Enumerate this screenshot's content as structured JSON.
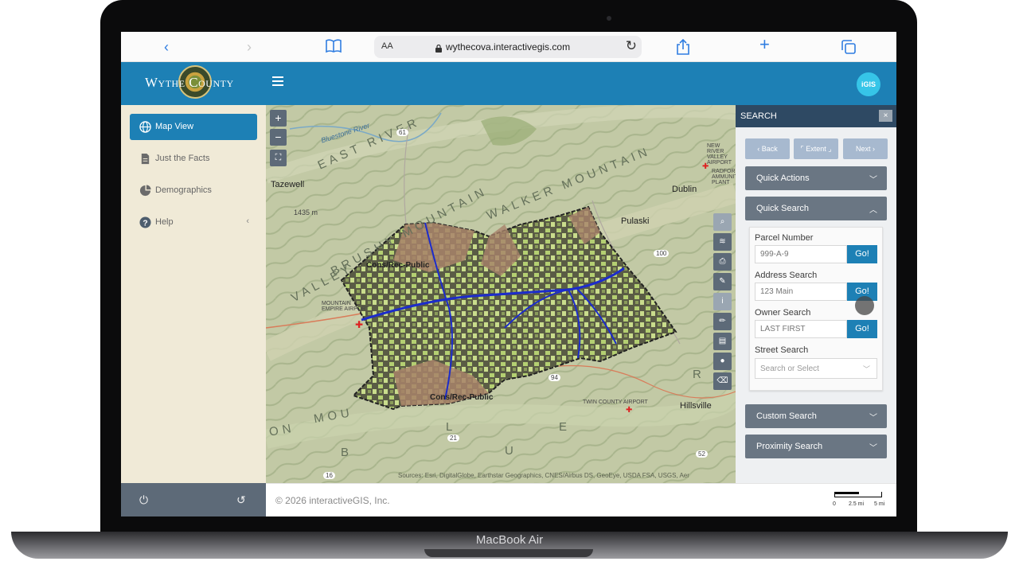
{
  "device": {
    "brand_label": "MacBook Air"
  },
  "browser": {
    "text_size_label": "AA",
    "url": "wythecova.interactivegis.com",
    "icons": [
      "back-icon",
      "forward-icon",
      "bookmarks-icon",
      "lock-icon",
      "reload-icon",
      "share-icon",
      "new-tab-icon",
      "tabs-icon"
    ]
  },
  "header": {
    "logo_text": "Wythe County",
    "badge_text": "iGIS",
    "color": "#1d80b5"
  },
  "sidebar": {
    "items": [
      {
        "label": "Map View",
        "icon": "globe-icon",
        "active": true
      },
      {
        "label": "Just the Facts",
        "icon": "document-icon",
        "active": false
      },
      {
        "label": "Demographics",
        "icon": "pie-chart-icon",
        "active": false
      },
      {
        "label": "Help",
        "icon": "help-icon",
        "active": false
      }
    ],
    "footer_icons": [
      "power-icon",
      "undo-icon"
    ]
  },
  "map": {
    "zoom_in": "+",
    "zoom_out": "−",
    "labels": {
      "tazewell": "Tazewell",
      "dublin": "Dublin",
      "pulaski": "Pulaski",
      "hillsville": "Hillsville",
      "cons_rec_1": "Cons/Rec-Public",
      "cons_rec_2": "Cons/Rec-Public",
      "elevation": "1435 m",
      "mountain_empire": "MOUNTAIN EMPIRE AIRPORT",
      "new_river_airport": "NEW RIVER VALLEY AIRPORT",
      "radford": "RADFORD AMMUNITION PLANT",
      "twin_county": "TWIN COUNTY AIRPORT",
      "bluestone": "Bluestone River",
      "ridge_east": "EAST RIVER",
      "ridge_brushy": "BRUSHY MOUNTAIN",
      "ridge_walker": "WALKER MOUNTAIN",
      "ridge_valley": "VALLEY",
      "road_61": "61",
      "road_100": "100",
      "road_94": "94",
      "road_21": "21",
      "road_16": "16",
      "road_52": "52",
      "letter_r": "R",
      "letter_b": "B",
      "letter_l": "L",
      "letter_u": "U",
      "letter_e": "E",
      "mountain_mou": "MOU",
      "mountain_on": "ON"
    },
    "attribution": "Sources: Esri, DigitalGlobe, Earthstar Geographics, CNES/Airbus DS, GeoEye, USDA FSA, USGS, Aer",
    "tools": [
      "search-icon",
      "layers-icon",
      "print-icon",
      "measure-icon",
      "info-icon",
      "draw-icon",
      "table-icon",
      "marker-icon",
      "eraser-icon"
    ]
  },
  "footer": {
    "copyright": "© 2026 interactiveGIS, Inc.",
    "scale": [
      "0",
      "2.5 mi",
      "5 mi"
    ]
  },
  "search": {
    "title": "SEARCH",
    "close": "×",
    "back": "‹ Back",
    "extent": "⌜ Extent ⌟",
    "next": "Next ›",
    "quick_actions": "Quick Actions",
    "quick_search": "Quick Search",
    "parcel_label": "Parcel Number",
    "parcel_placeholder": "999-A-9",
    "address_label": "Address Search",
    "address_placeholder": "123 Main",
    "owner_label": "Owner Search",
    "owner_placeholder": "LAST FIRST",
    "go": "Go!",
    "street_label": "Street Search",
    "street_placeholder": "Search or Select",
    "custom_search": "Custom Search",
    "proximity_search": "Proximity Search"
  }
}
